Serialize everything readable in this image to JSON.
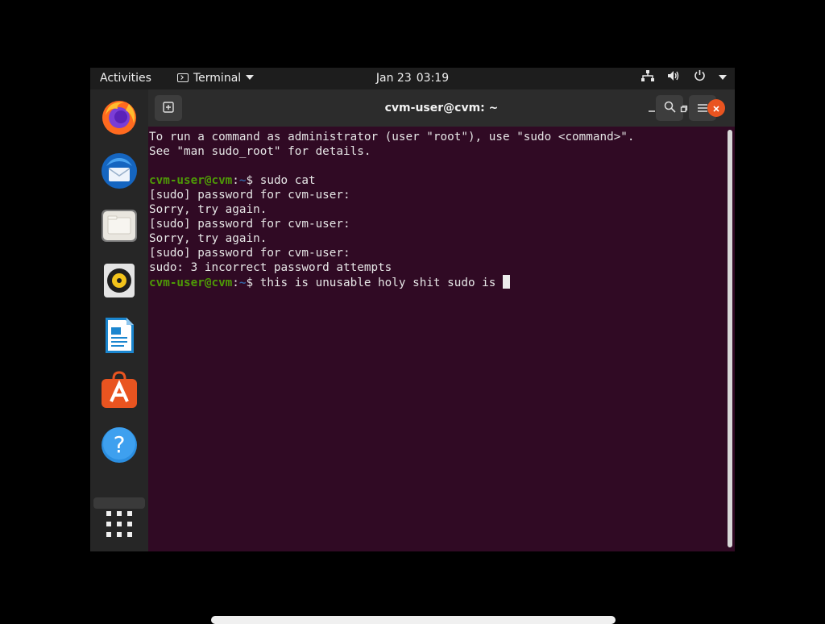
{
  "topbar": {
    "activities": "Activities",
    "app_menu": "Terminal",
    "clock_date": "Jan 23",
    "clock_time": "03:19"
  },
  "dock": {
    "items": [
      "firefox-icon",
      "thunderbird-icon",
      "files-icon",
      "rhythmbox-icon",
      "libreoffice-writer-icon",
      "ubuntu-software-icon",
      "help-icon",
      "show-apps-icon"
    ]
  },
  "window": {
    "title": "cvm-user@cvm: ~"
  },
  "terminal": {
    "lines": [
      {
        "text": "To run a command as administrator (user \"root\"), use \"sudo <command>\"."
      },
      {
        "text": "See \"man sudo_root\" for details."
      },
      {
        "text": ""
      },
      {
        "user": "cvm-user@cvm",
        "sep": ":",
        "path": "~",
        "sym": "$ ",
        "cmd": "sudo cat"
      },
      {
        "text": "[sudo] password for cvm-user:"
      },
      {
        "text": "Sorry, try again."
      },
      {
        "text": "[sudo] password for cvm-user:"
      },
      {
        "text": "Sorry, try again."
      },
      {
        "text": "[sudo] password for cvm-user:"
      },
      {
        "text": "sudo: 3 incorrect password attempts"
      },
      {
        "user": "cvm-user@cvm",
        "sep": ":",
        "path": "~",
        "sym": "$ ",
        "cmd": "this is unusable holy shit sudo is ",
        "cursor": true
      }
    ]
  },
  "colors": {
    "terminal_bg": "#300a24",
    "prompt_user": "#4e9a06",
    "prompt_path": "#3465a4",
    "close_button": "#e95420"
  }
}
